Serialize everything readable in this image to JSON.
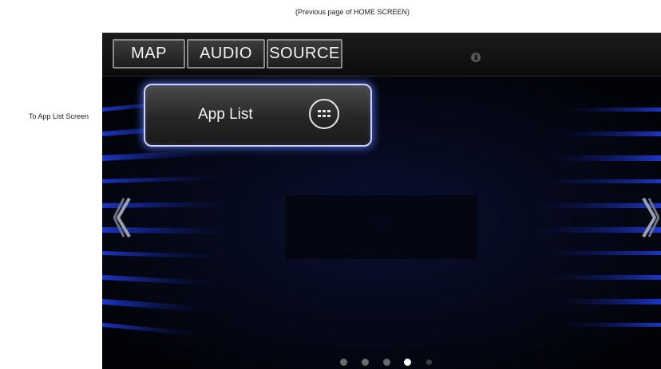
{
  "captions": {
    "top": "(Previous page of HOME SCREEN)",
    "left": "To App List Screen"
  },
  "topbar": {
    "tabs": [
      {
        "label": "MAP"
      },
      {
        "label": "AUDIO"
      },
      {
        "label": "SOURCE"
      }
    ],
    "status_icon": "bluetooth-icon"
  },
  "main": {
    "app_list_button": {
      "label": "App List",
      "icon": "grid-dots-icon"
    },
    "nav": {
      "left_icon": "chevron-left-icon",
      "right_icon": "chevron-right-icon"
    },
    "page_indicator": {
      "total": 5,
      "current": 4
    }
  },
  "colors": {
    "accent": "#4a66ff",
    "button_border": "#cdd3ff",
    "screen_bg": "#05070d"
  }
}
